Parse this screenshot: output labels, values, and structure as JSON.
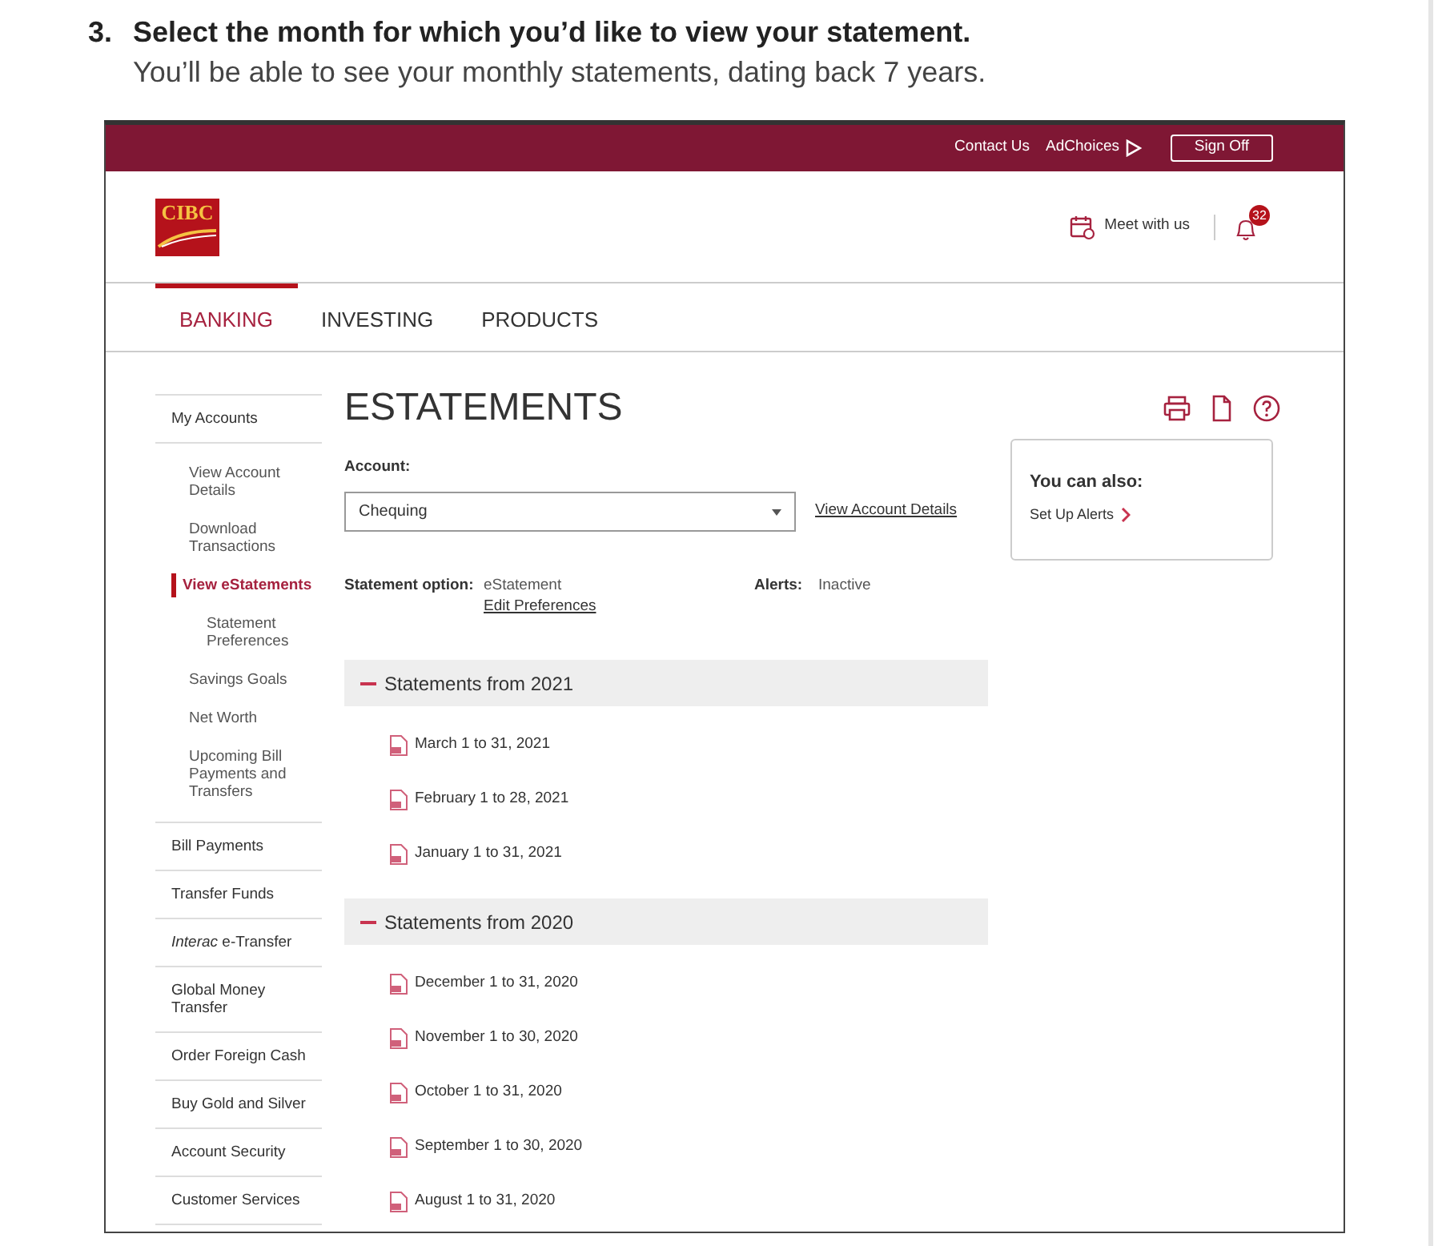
{
  "instruction": {
    "number": "3.",
    "title": "Select the month for which you’d like to view your statement.",
    "subtitle": "You’ll be able to see your monthly statements, dating back 7 years."
  },
  "top_bar": {
    "links": [
      "Contact Us",
      "AdChoices"
    ],
    "button": "Sign Off"
  },
  "header": {
    "logo": "CIBC",
    "meet": "Meet with us",
    "notification_count": "32"
  },
  "nav": [
    {
      "label": "BANKING",
      "selected": true
    },
    {
      "label": "INVESTING",
      "selected": false
    },
    {
      "label": "PRODUCTS",
      "selected": false
    }
  ],
  "sidebar": [
    {
      "label": "My Accounts",
      "selected": false,
      "children": [
        {
          "label": "View Account Details",
          "selected": false
        },
        {
          "label": "Download Transactions",
          "selected": false
        },
        {
          "label": "View eStatements",
          "selected": true,
          "children": [
            {
              "label": "Statement Preferences",
              "selected": false
            }
          ]
        },
        {
          "label": "Savings Goals",
          "selected": false
        },
        {
          "label": "Net Worth",
          "selected": false
        },
        {
          "label": "Upcoming Bill Payments and Transfers",
          "selected": false
        }
      ]
    },
    {
      "label": "Bill Payments",
      "selected": false
    },
    {
      "label": "Transfer Funds",
      "selected": false
    },
    {
      "label": "*Interac* e-Transfer",
      "selected": false
    },
    {
      "label": "Global Money Transfer",
      "selected": false
    },
    {
      "label": "Order Foreign Cash",
      "selected": false
    },
    {
      "label": "Buy Gold and Silver",
      "selected": false
    },
    {
      "label": "Account Security",
      "selected": false
    },
    {
      "label": "Customer Services",
      "selected": false
    }
  ],
  "page_title": "ESTATEMENTS",
  "account": {
    "label": "Account:",
    "value": "Chequing",
    "link": "View Account Details"
  },
  "statement_option": {
    "label": "Statement option:",
    "value": "eStatement",
    "link": "Edit Preferences"
  },
  "alerts": {
    "label": "Alerts:",
    "value": "Inactive"
  },
  "sections": [
    {
      "title": "Statements from 2021",
      "expanded": true,
      "statements": [
        "March 1 to 31, 2021",
        "February 1 to 28, 2021",
        "January 1 to 31, 2021"
      ]
    },
    {
      "title": "Statements from 2020",
      "expanded": true,
      "statements": [
        "December 1 to 31, 2020",
        "November 1 to 30, 2020",
        "October 1 to 31, 2020",
        "September 1 to 30, 2020",
        "August 1 to 31, 2020"
      ]
    }
  ],
  "side_card": {
    "title": "You can also:",
    "link": "Set Up Alerts"
  }
}
